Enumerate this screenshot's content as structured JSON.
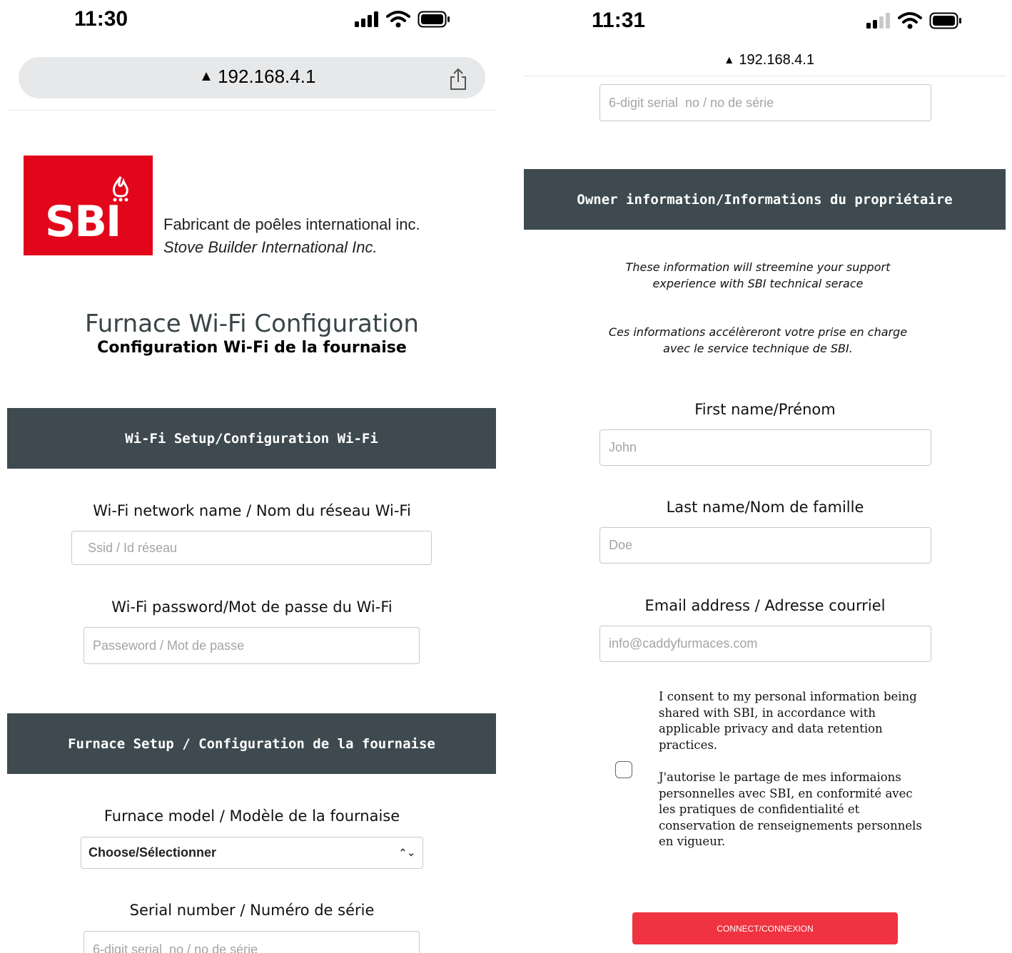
{
  "left": {
    "status": {
      "time": "11:30"
    },
    "address_bar": {
      "url": "192.168.4.1"
    },
    "logo": {
      "text": "SBI",
      "company_fr": "Fabricant de poêles international inc.",
      "company_en": "Stove Builder International Inc."
    },
    "title": "Furnace Wi-Fi Configuration",
    "subtitle": "Configuration Wi-Fi de la fournaise",
    "wifi_section": {
      "heading": "Wi-Fi Setup/Configuration Wi-Fi",
      "network_label": "Wi-Fi network name / Nom du réseau Wi-Fi",
      "network_placeholder": "Ssid / Id réseau",
      "password_label": "Wi-Fi password/Mot de passe du Wi-Fi",
      "password_placeholder": "Passeword / Mot de passe"
    },
    "furnace_section": {
      "heading": "Furnace Setup / Configuration de la fournaise",
      "model_label": "Furnace model / Modèle de la fournaise",
      "model_selected": "Choose/Sélectionner",
      "serial_label": "Serial number / Numéro de série",
      "serial_placeholder": "6-digit serial  no / no de série"
    }
  },
  "right": {
    "status": {
      "time": "11:31"
    },
    "address_bar": {
      "url": "192.168.4.1"
    },
    "serial_placeholder": "6-digit serial  no / no de série",
    "owner_section": {
      "heading": "Owner information/Informations du propriétaire",
      "note_en_line1": "These information will streemine your support",
      "note_en_line2": "experience with SBI technical serace",
      "note_fr_line1": "Ces informations accélèreront votre prise en charge",
      "note_fr_line2": "avec le service technique de SBI.",
      "first_name_label": "First name/Prénom",
      "first_name_placeholder": "John",
      "last_name_label": "Last name/Nom de famille",
      "last_name_placeholder": "Doe",
      "email_label": "Email address / Adresse courriel",
      "email_placeholder": "info@caddyfurmaces.com"
    },
    "consent": {
      "en": "I consent to my personal information being shared with SBI, in accordance with applicable privacy and data retention practices.",
      "fr": "J'autorise le partage de mes informaions personnelles avec SBI, en conformité avec les pratiques de confidentialité et conservation de renseignements personnels en vigueur."
    },
    "connect_button": "CONNECT/CONNEXION"
  },
  "colors": {
    "brand_red": "#e2061b",
    "section_band": "#3e4a4f",
    "button_red": "#ef3340",
    "title_gray": "#394447"
  },
  "icons": [
    "cellular-signal-icon",
    "wifi-icon",
    "battery-icon",
    "warning-icon",
    "share-icon",
    "flame-icon",
    "chevron-updown-icon"
  ]
}
